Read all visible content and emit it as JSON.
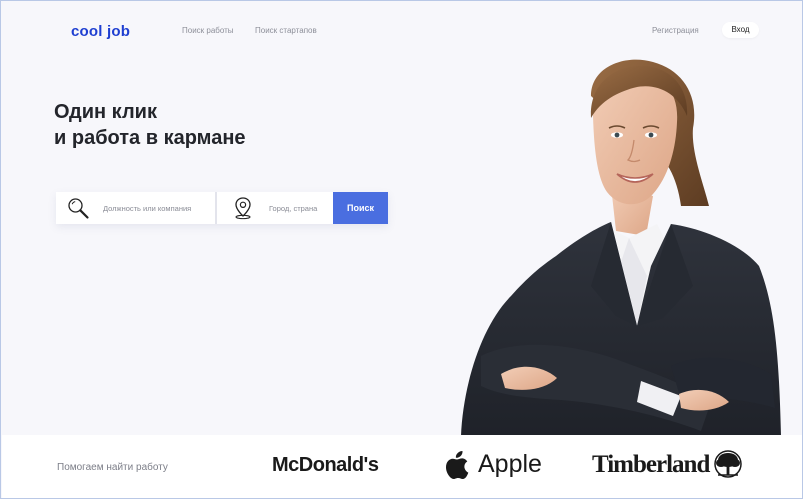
{
  "header": {
    "logo": "cool job",
    "nav": [
      "Поиск работы",
      "Поиск стартапов"
    ],
    "register": "Регистрация",
    "login": "Вход"
  },
  "hero": {
    "title_line1": "Один клик",
    "title_line2": "и работа в кармане"
  },
  "search": {
    "job_placeholder": "Должность или компания",
    "city_placeholder": "Город, страна",
    "button": "Поиск",
    "icons": [
      "search-icon",
      "location-pin-icon"
    ]
  },
  "partners": {
    "label": "Помогаем найти работу",
    "brands": [
      "McDonald's",
      "Apple",
      "Timberland"
    ]
  },
  "colors": {
    "brand": "#1f3fd1",
    "button": "#4a6ee0",
    "background": "#f7f7fb"
  }
}
